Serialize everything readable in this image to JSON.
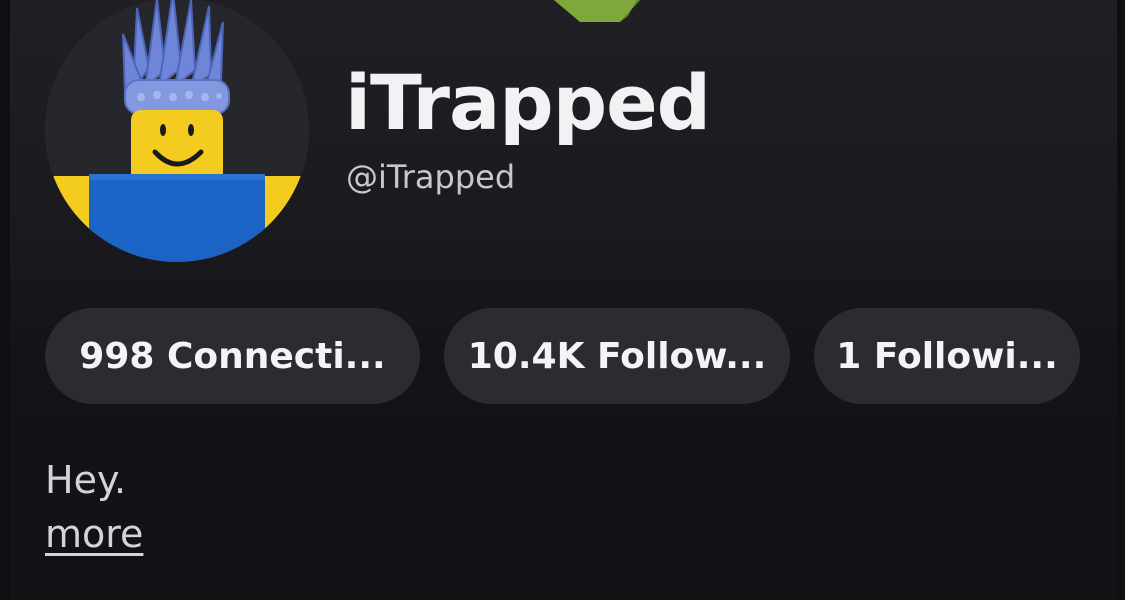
{
  "profile": {
    "display_name": "iTrapped",
    "username": "@iTrapped",
    "bio": "Hey.",
    "more_label": "more",
    "avatar_icon": "roblox-noob-avatar-with-blue-crown"
  },
  "stats": {
    "connections_label": "998 Connecti...",
    "followers_label": "10.4K Follow...",
    "following_label": "1 Followi..."
  },
  "colors": {
    "background": "#131318",
    "pill_background": "#2b2b31",
    "text_primary": "#f2f2f4",
    "text_secondary": "#c8c8cc",
    "avatar_skin": "#f5cd2a",
    "avatar_shirt": "#1b66c9",
    "avatar_crown": "#7b8fd6"
  }
}
